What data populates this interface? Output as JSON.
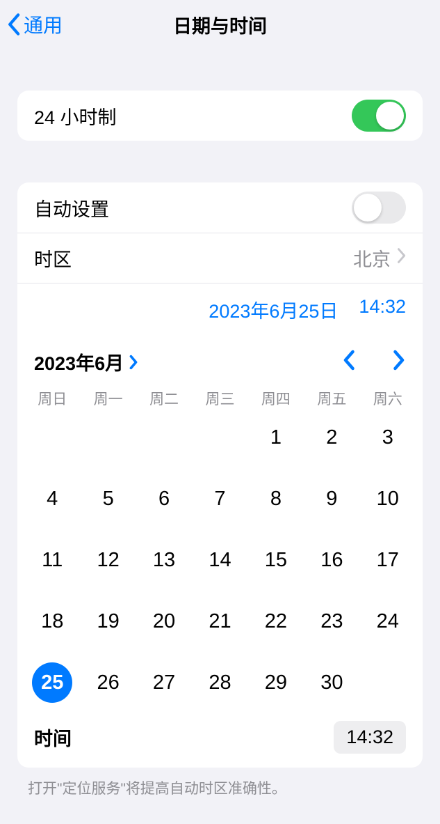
{
  "nav": {
    "back": "通用",
    "title": "日期与时间"
  },
  "clock24": {
    "label": "24 小时制",
    "on": true
  },
  "autoset": {
    "label": "自动设置",
    "on": false
  },
  "timezone": {
    "label": "时区",
    "value": "北京"
  },
  "display": {
    "date": "2023年6月25日",
    "time": "14:32"
  },
  "month": {
    "label": "2023年6月"
  },
  "weekdays": [
    "周日",
    "周一",
    "周二",
    "周三",
    "周四",
    "周五",
    "周六"
  ],
  "calendar": {
    "leading_blanks": 4,
    "days": [
      1,
      2,
      3,
      4,
      5,
      6,
      7,
      8,
      9,
      10,
      11,
      12,
      13,
      14,
      15,
      16,
      17,
      18,
      19,
      20,
      21,
      22,
      23,
      24,
      25,
      26,
      27,
      28,
      29,
      30
    ],
    "selected": 25
  },
  "timeRow": {
    "label": "时间",
    "value": "14:32"
  },
  "footer": "打开\"定位服务\"将提高自动时区准确性。"
}
